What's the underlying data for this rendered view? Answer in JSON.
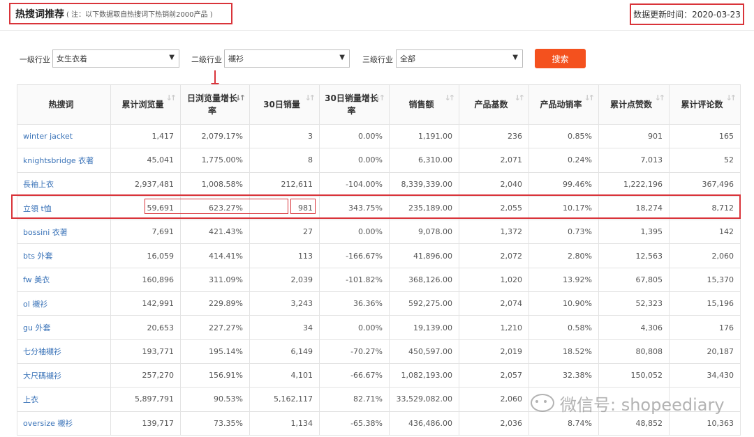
{
  "header": {
    "title": "热搜词推荐",
    "note": "( 注：以下数据取自热搜词下热销前2000产品 )",
    "update_label": "数据更新时间：",
    "update_date": "2020-03-23"
  },
  "filters": {
    "level1": {
      "label": "一级行业",
      "value": "女生衣着"
    },
    "level2": {
      "label": "二级行业",
      "value": "襯衫"
    },
    "level3": {
      "label": "三级行业",
      "value": "全部"
    },
    "search_label": "搜索"
  },
  "table": {
    "columns": [
      "热搜词",
      "累计浏览量",
      "日浏览量增长率",
      "30日销量",
      "30日销量增长率",
      "销售额",
      "产品基数",
      "产品动销率",
      "累计点赞数",
      "累计评论数"
    ],
    "rows": [
      [
        "winter jacket",
        "1,417",
        "2,079.17%",
        "3",
        "0.00%",
        "1,191.00",
        "236",
        "0.85%",
        "901",
        "165"
      ],
      [
        "knightsbridge 衣著",
        "45,041",
        "1,775.00%",
        "8",
        "0.00%",
        "6,310.00",
        "2,071",
        "0.24%",
        "7,013",
        "52"
      ],
      [
        "長袖上衣",
        "2,937,481",
        "1,008.58%",
        "212,611",
        "-104.00%",
        "8,339,339.00",
        "2,040",
        "99.46%",
        "1,222,196",
        "367,496"
      ],
      [
        "立領 t恤",
        "59,691",
        "623.27%",
        "981",
        "343.75%",
        "235,189.00",
        "2,055",
        "10.17%",
        "18,274",
        "8,712"
      ],
      [
        "bossini 衣著",
        "7,691",
        "421.43%",
        "27",
        "0.00%",
        "9,078.00",
        "1,372",
        "0.73%",
        "1,395",
        "142"
      ],
      [
        "bts 外套",
        "16,059",
        "414.41%",
        "113",
        "-166.67%",
        "41,896.00",
        "2,072",
        "2.80%",
        "12,563",
        "2,060"
      ],
      [
        "fw 美衣",
        "160,896",
        "311.09%",
        "2,039",
        "-101.82%",
        "368,126.00",
        "1,020",
        "13.92%",
        "67,805",
        "15,370"
      ],
      [
        "ol 襯衫",
        "142,991",
        "229.89%",
        "3,243",
        "36.36%",
        "592,275.00",
        "2,074",
        "10.90%",
        "52,323",
        "15,196"
      ],
      [
        "gu 外套",
        "20,653",
        "227.27%",
        "34",
        "0.00%",
        "19,139.00",
        "1,210",
        "0.58%",
        "4,306",
        "176"
      ],
      [
        "七分袖襯衫",
        "193,771",
        "195.14%",
        "6,149",
        "-70.27%",
        "450,597.00",
        "2,019",
        "18.52%",
        "80,808",
        "20,187"
      ],
      [
        "大尺碼襯衫",
        "257,270",
        "156.91%",
        "4,101",
        "-66.67%",
        "1,082,193.00",
        "2,057",
        "32.38%",
        "150,052",
        "34,430"
      ],
      [
        "上衣",
        "5,897,791",
        "90.53%",
        "5,162,117",
        "82.71%",
        "33,529,082.00",
        "2,060",
        "",
        "",
        ""
      ],
      [
        "oversize 襯衫",
        "139,717",
        "73.35%",
        "1,134",
        "-65.38%",
        "436,486.00",
        "2,036",
        "8.74%",
        "48,852",
        "10,363"
      ]
    ]
  },
  "watermark": {
    "text": "微信号: shopeediary",
    "icon": "wechat-icon"
  }
}
